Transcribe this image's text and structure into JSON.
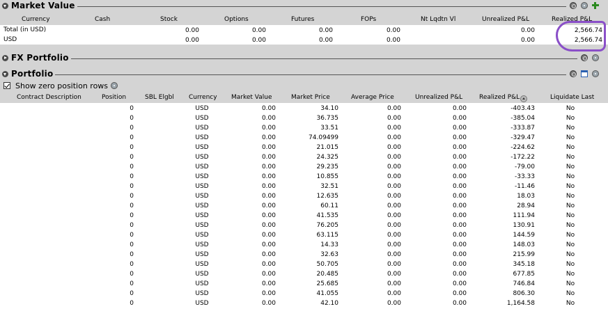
{
  "market_value": {
    "title": "Market Value",
    "columns": [
      "Currency",
      "Cash",
      "Stock",
      "Options",
      "Futures",
      "FOPs",
      "Nt Lqdtn Vl",
      "Unrealized P&L",
      "Realized P&L"
    ],
    "rows": [
      {
        "currency": "Total (in USD)",
        "stock": "0.00",
        "options": "0.00",
        "futures": "0.00",
        "fops": "0.00",
        "unrealized": "0.00",
        "realized": "2,566.74"
      },
      {
        "currency": "USD",
        "stock": "0.00",
        "options": "0.00",
        "futures": "0.00",
        "fops": "0.00",
        "unrealized": "0.00",
        "realized": "2,566.74"
      }
    ]
  },
  "fx_portfolio": {
    "title": "FX Portfolio"
  },
  "portfolio": {
    "title": "Portfolio",
    "show_zero_label": "Show zero position rows",
    "columns": [
      "Contract Description",
      "Position",
      "SBL Elgbl",
      "Currency",
      "Market Value",
      "Market Price",
      "Average Price",
      "Unrealized P&L",
      "Realized P&L",
      "Liquidate Last"
    ],
    "rows": [
      {
        "position": "0",
        "currency": "USD",
        "market_value": "0.00",
        "market_price": "34.10",
        "avg_price": "0.00",
        "unrealized": "0.00",
        "realized": "-403.43",
        "liquidate": "No"
      },
      {
        "position": "0",
        "currency": "USD",
        "market_value": "0.00",
        "market_price": "36.735",
        "avg_price": "0.00",
        "unrealized": "0.00",
        "realized": "-385.04",
        "liquidate": "No"
      },
      {
        "position": "0",
        "currency": "USD",
        "market_value": "0.00",
        "market_price": "33.51",
        "avg_price": "0.00",
        "unrealized": "0.00",
        "realized": "-333.87",
        "liquidate": "No"
      },
      {
        "position": "0",
        "currency": "USD",
        "market_value": "0.00",
        "market_price": "74.09499",
        "avg_price": "0.00",
        "unrealized": "0.00",
        "realized": "-329.47",
        "liquidate": "No"
      },
      {
        "position": "0",
        "currency": "USD",
        "market_value": "0.00",
        "market_price": "21.015",
        "avg_price": "0.00",
        "unrealized": "0.00",
        "realized": "-224.62",
        "liquidate": "No"
      },
      {
        "position": "0",
        "currency": "USD",
        "market_value": "0.00",
        "market_price": "24.325",
        "avg_price": "0.00",
        "unrealized": "0.00",
        "realized": "-172.22",
        "liquidate": "No"
      },
      {
        "position": "0",
        "currency": "USD",
        "market_value": "0.00",
        "market_price": "29.235",
        "avg_price": "0.00",
        "unrealized": "0.00",
        "realized": "-79.00",
        "liquidate": "No"
      },
      {
        "position": "0",
        "currency": "USD",
        "market_value": "0.00",
        "market_price": "10.855",
        "avg_price": "0.00",
        "unrealized": "0.00",
        "realized": "-33.33",
        "liquidate": "No"
      },
      {
        "position": "0",
        "currency": "USD",
        "market_value": "0.00",
        "market_price": "32.51",
        "avg_price": "0.00",
        "unrealized": "0.00",
        "realized": "-11.46",
        "liquidate": "No"
      },
      {
        "position": "0",
        "currency": "USD",
        "market_value": "0.00",
        "market_price": "12.635",
        "avg_price": "0.00",
        "unrealized": "0.00",
        "realized": "18.03",
        "liquidate": "No"
      },
      {
        "position": "0",
        "currency": "USD",
        "market_value": "0.00",
        "market_price": "60.11",
        "avg_price": "0.00",
        "unrealized": "0.00",
        "realized": "28.94",
        "liquidate": "No"
      },
      {
        "position": "0",
        "currency": "USD",
        "market_value": "0.00",
        "market_price": "41.535",
        "avg_price": "0.00",
        "unrealized": "0.00",
        "realized": "111.94",
        "liquidate": "No"
      },
      {
        "position": "0",
        "currency": "USD",
        "market_value": "0.00",
        "market_price": "76.205",
        "avg_price": "0.00",
        "unrealized": "0.00",
        "realized": "130.91",
        "liquidate": "No"
      },
      {
        "position": "0",
        "currency": "USD",
        "market_value": "0.00",
        "market_price": "63.115",
        "avg_price": "0.00",
        "unrealized": "0.00",
        "realized": "144.59",
        "liquidate": "No"
      },
      {
        "position": "0",
        "currency": "USD",
        "market_value": "0.00",
        "market_price": "14.33",
        "avg_price": "0.00",
        "unrealized": "0.00",
        "realized": "148.03",
        "liquidate": "No"
      },
      {
        "position": "0",
        "currency": "USD",
        "market_value": "0.00",
        "market_price": "32.63",
        "avg_price": "0.00",
        "unrealized": "0.00",
        "realized": "215.99",
        "liquidate": "No"
      },
      {
        "position": "0",
        "currency": "USD",
        "market_value": "0.00",
        "market_price": "50.705",
        "avg_price": "0.00",
        "unrealized": "0.00",
        "realized": "345.18",
        "liquidate": "No"
      },
      {
        "position": "0",
        "currency": "USD",
        "market_value": "0.00",
        "market_price": "20.485",
        "avg_price": "0.00",
        "unrealized": "0.00",
        "realized": "677.85",
        "liquidate": "No"
      },
      {
        "position": "0",
        "currency": "USD",
        "market_value": "0.00",
        "market_price": "25.685",
        "avg_price": "0.00",
        "unrealized": "0.00",
        "realized": "746.84",
        "liquidate": "No"
      },
      {
        "position": "0",
        "currency": "USD",
        "market_value": "0.00",
        "market_price": "41.055",
        "avg_price": "0.00",
        "unrealized": "0.00",
        "realized": "806.30",
        "liquidate": "No"
      },
      {
        "position": "0",
        "currency": "USD",
        "market_value": "0.00",
        "market_price": "42.10",
        "avg_price": "0.00",
        "unrealized": "0.00",
        "realized": "1,164.58",
        "liquidate": "No"
      }
    ]
  },
  "icons": {
    "toggle": "collapse-toggle-icon",
    "link": "link-icon",
    "info": "info-icon",
    "add": "plus-icon",
    "window": "detach-window-icon",
    "sort": "sort-icon"
  },
  "colors": {
    "annotation": "#8a4fc8",
    "background": "#d4d4d4"
  }
}
